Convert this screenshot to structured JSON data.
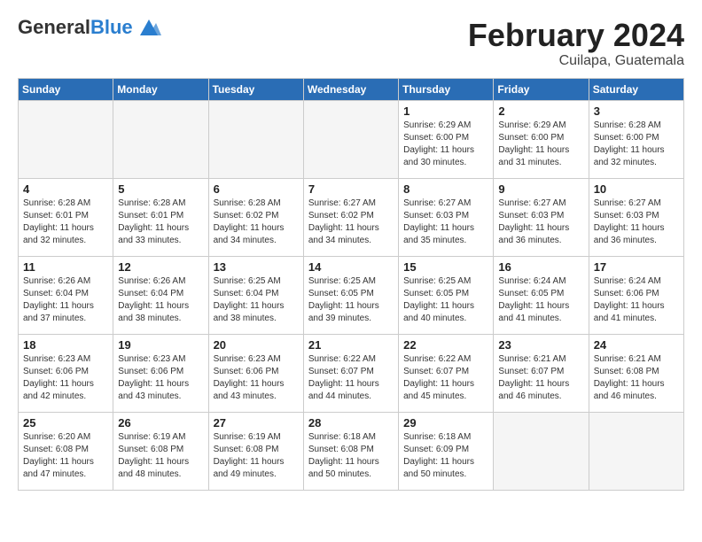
{
  "header": {
    "logo_general": "General",
    "logo_blue": "Blue",
    "month": "February 2024",
    "location": "Cuilapa, Guatemala"
  },
  "days_of_week": [
    "Sunday",
    "Monday",
    "Tuesday",
    "Wednesday",
    "Thursday",
    "Friday",
    "Saturday"
  ],
  "weeks": [
    [
      {
        "day": "",
        "empty": true
      },
      {
        "day": "",
        "empty": true
      },
      {
        "day": "",
        "empty": true
      },
      {
        "day": "",
        "empty": true
      },
      {
        "day": "1",
        "sunrise": "6:29 AM",
        "sunset": "6:00 PM",
        "daylight": "11 hours and 30 minutes."
      },
      {
        "day": "2",
        "sunrise": "6:29 AM",
        "sunset": "6:00 PM",
        "daylight": "11 hours and 31 minutes."
      },
      {
        "day": "3",
        "sunrise": "6:28 AM",
        "sunset": "6:00 PM",
        "daylight": "11 hours and 32 minutes."
      }
    ],
    [
      {
        "day": "4",
        "sunrise": "6:28 AM",
        "sunset": "6:01 PM",
        "daylight": "11 hours and 32 minutes."
      },
      {
        "day": "5",
        "sunrise": "6:28 AM",
        "sunset": "6:01 PM",
        "daylight": "11 hours and 33 minutes."
      },
      {
        "day": "6",
        "sunrise": "6:28 AM",
        "sunset": "6:02 PM",
        "daylight": "11 hours and 34 minutes."
      },
      {
        "day": "7",
        "sunrise": "6:27 AM",
        "sunset": "6:02 PM",
        "daylight": "11 hours and 34 minutes."
      },
      {
        "day": "8",
        "sunrise": "6:27 AM",
        "sunset": "6:03 PM",
        "daylight": "11 hours and 35 minutes."
      },
      {
        "day": "9",
        "sunrise": "6:27 AM",
        "sunset": "6:03 PM",
        "daylight": "11 hours and 36 minutes."
      },
      {
        "day": "10",
        "sunrise": "6:27 AM",
        "sunset": "6:03 PM",
        "daylight": "11 hours and 36 minutes."
      }
    ],
    [
      {
        "day": "11",
        "sunrise": "6:26 AM",
        "sunset": "6:04 PM",
        "daylight": "11 hours and 37 minutes."
      },
      {
        "day": "12",
        "sunrise": "6:26 AM",
        "sunset": "6:04 PM",
        "daylight": "11 hours and 38 minutes."
      },
      {
        "day": "13",
        "sunrise": "6:25 AM",
        "sunset": "6:04 PM",
        "daylight": "11 hours and 38 minutes."
      },
      {
        "day": "14",
        "sunrise": "6:25 AM",
        "sunset": "6:05 PM",
        "daylight": "11 hours and 39 minutes."
      },
      {
        "day": "15",
        "sunrise": "6:25 AM",
        "sunset": "6:05 PM",
        "daylight": "11 hours and 40 minutes."
      },
      {
        "day": "16",
        "sunrise": "6:24 AM",
        "sunset": "6:05 PM",
        "daylight": "11 hours and 41 minutes."
      },
      {
        "day": "17",
        "sunrise": "6:24 AM",
        "sunset": "6:06 PM",
        "daylight": "11 hours and 41 minutes."
      }
    ],
    [
      {
        "day": "18",
        "sunrise": "6:23 AM",
        "sunset": "6:06 PM",
        "daylight": "11 hours and 42 minutes."
      },
      {
        "day": "19",
        "sunrise": "6:23 AM",
        "sunset": "6:06 PM",
        "daylight": "11 hours and 43 minutes."
      },
      {
        "day": "20",
        "sunrise": "6:23 AM",
        "sunset": "6:06 PM",
        "daylight": "11 hours and 43 minutes."
      },
      {
        "day": "21",
        "sunrise": "6:22 AM",
        "sunset": "6:07 PM",
        "daylight": "11 hours and 44 minutes."
      },
      {
        "day": "22",
        "sunrise": "6:22 AM",
        "sunset": "6:07 PM",
        "daylight": "11 hours and 45 minutes."
      },
      {
        "day": "23",
        "sunrise": "6:21 AM",
        "sunset": "6:07 PM",
        "daylight": "11 hours and 46 minutes."
      },
      {
        "day": "24",
        "sunrise": "6:21 AM",
        "sunset": "6:08 PM",
        "daylight": "11 hours and 46 minutes."
      }
    ],
    [
      {
        "day": "25",
        "sunrise": "6:20 AM",
        "sunset": "6:08 PM",
        "daylight": "11 hours and 47 minutes."
      },
      {
        "day": "26",
        "sunrise": "6:19 AM",
        "sunset": "6:08 PM",
        "daylight": "11 hours and 48 minutes."
      },
      {
        "day": "27",
        "sunrise": "6:19 AM",
        "sunset": "6:08 PM",
        "daylight": "11 hours and 49 minutes."
      },
      {
        "day": "28",
        "sunrise": "6:18 AM",
        "sunset": "6:08 PM",
        "daylight": "11 hours and 50 minutes."
      },
      {
        "day": "29",
        "sunrise": "6:18 AM",
        "sunset": "6:09 PM",
        "daylight": "11 hours and 50 minutes."
      },
      {
        "day": "",
        "empty": true
      },
      {
        "day": "",
        "empty": true
      }
    ]
  ],
  "labels": {
    "sunrise": "Sunrise:",
    "sunset": "Sunset:",
    "daylight": "Daylight:"
  }
}
